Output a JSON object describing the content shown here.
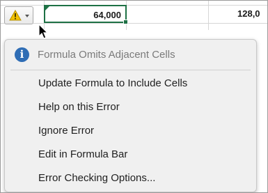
{
  "sheet": {
    "cells": [
      {
        "value": "64,000",
        "selected": true
      },
      {
        "value": "128,0",
        "selected": false
      }
    ],
    "colors": {
      "selection_border": "#1e7145",
      "gridline": "#d6d6d6"
    }
  },
  "error_button": {
    "icon": "warning-triangle-icon",
    "dropdown_icon": "caret-down-icon",
    "warning_color": "#f2c200"
  },
  "menu": {
    "header_icon": "info-icon",
    "header_icon_glyph": "i",
    "header_icon_color": "#2f6db5",
    "title": "Formula Omits Adjacent Cells",
    "items": [
      {
        "label": "Update Formula to Include Cells"
      },
      {
        "label": "Help on this Error"
      },
      {
        "label": "Ignore Error"
      },
      {
        "label": "Edit in Formula Bar"
      },
      {
        "label": "Error Checking Options..."
      }
    ]
  }
}
